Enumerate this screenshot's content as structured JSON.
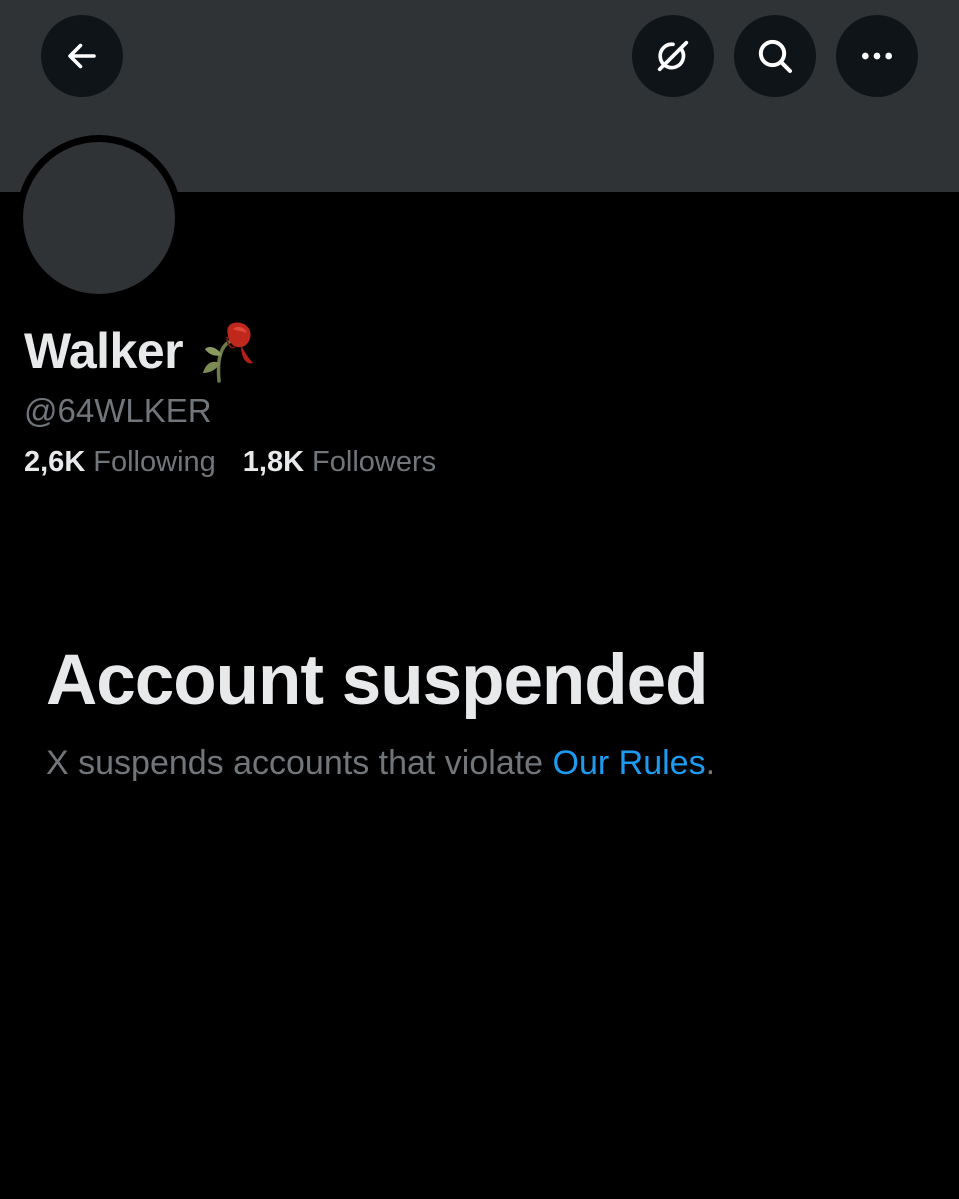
{
  "header": {
    "back_icon": "arrow-left-icon",
    "grok_icon": "grok-slash-circle-icon",
    "search_icon": "search-icon",
    "more_icon": "more-horizontal-icon"
  },
  "profile": {
    "display_name": "Walker",
    "name_emoji": "wilted-rose-emoji",
    "handle": "@64WLKER",
    "following_count": "2,6K",
    "following_label": "Following",
    "followers_count": "1,8K",
    "followers_label": "Followers"
  },
  "suspension": {
    "title": "Account suspended",
    "description": "X suspends accounts that violate ",
    "link_text": "Our Rules",
    "period": "."
  },
  "colors": {
    "background": "#000000",
    "banner": "#2f3336",
    "primary_text": "#e7e9ea",
    "secondary_text": "#71767b",
    "link": "#1d9bf0"
  }
}
